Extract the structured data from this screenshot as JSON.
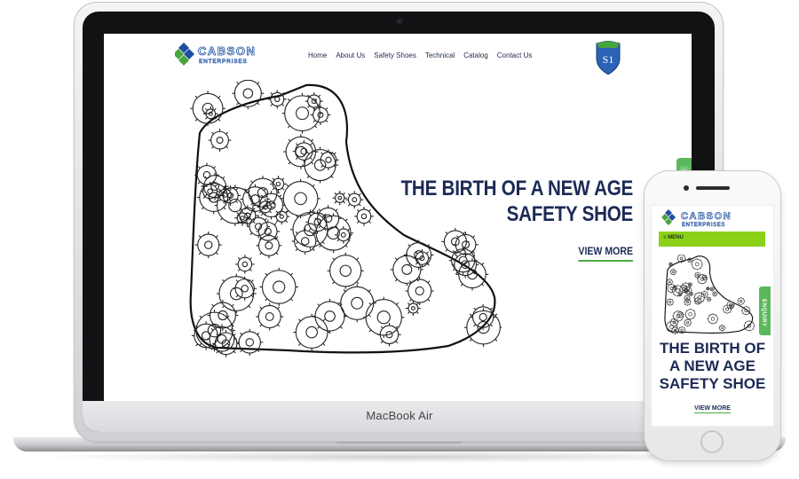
{
  "laptop": {
    "model_label": "MacBook Air"
  },
  "site": {
    "brand_name": "CABSON",
    "brand_tagline": "ENTERPRISES",
    "nav": [
      "Home",
      "About Us",
      "Safety Shoes",
      "Technical",
      "Catalog",
      "Contact Us"
    ],
    "badge_text": "S1",
    "hero": {
      "headline_line1": "THE BIRTH OF A NEW AGE",
      "headline_line2": "SAFETY SHOE",
      "cta_label": "VIEW MORE"
    },
    "whatsapp_icon": "whatsapp-icon"
  },
  "mobile": {
    "menu_label": "≡ MENU",
    "enquiry_label": "ENQUIRY",
    "headline_line1": "THE BIRTH OF",
    "headline_line2": "A NEW AGE",
    "headline_line3": "SAFETY SHOE",
    "cta_label": "VIEW MORE"
  },
  "colors": {
    "navy": "#1c2a55",
    "accent_green": "#4caf3f",
    "menu_green": "#8bd119",
    "logo_blue": "#1e4fa0",
    "logo_green": "#49a43b"
  }
}
